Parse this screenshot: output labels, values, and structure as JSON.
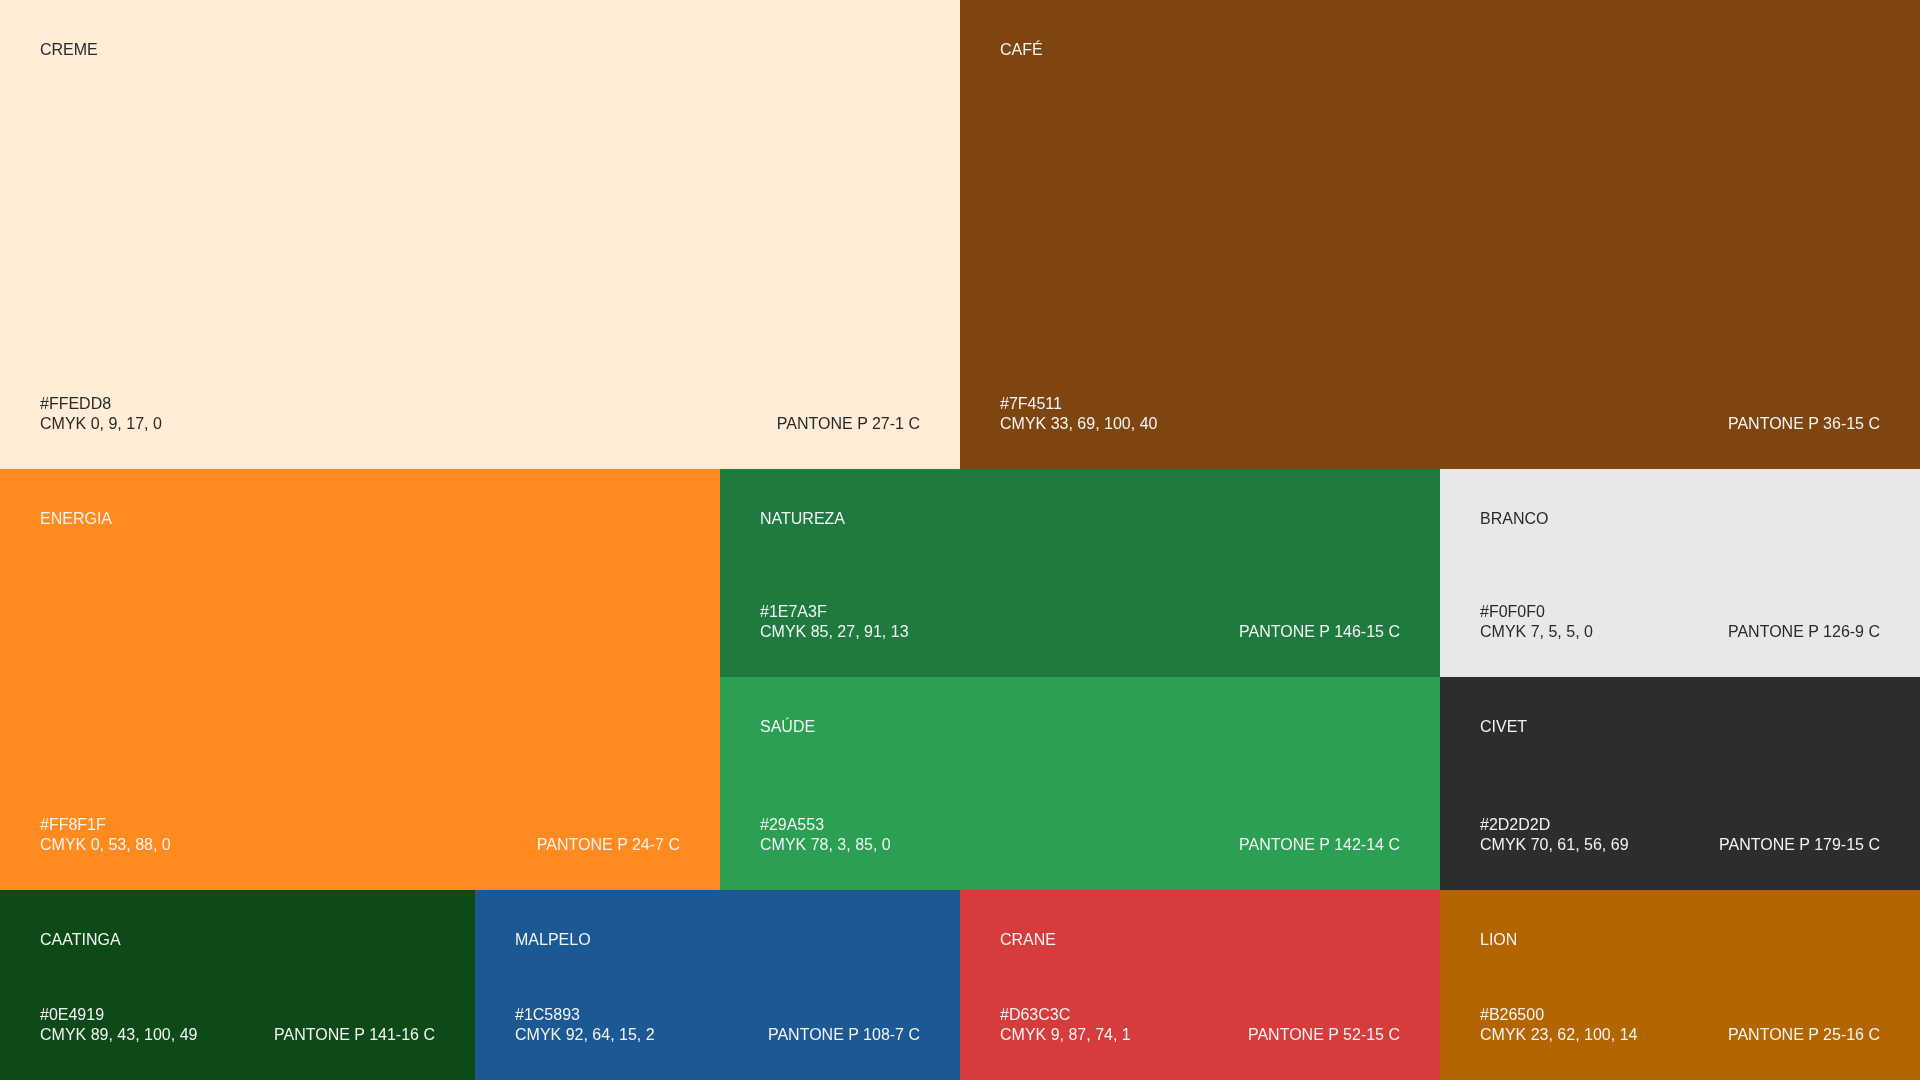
{
  "swatches": [
    {
      "name": "CREME",
      "hex": "#FFEDD8",
      "cmyk": "CMYK 0, 9, 17, 0",
      "pantone": "PANTONE P 27-1 C",
      "color": "#ffedd8"
    },
    {
      "name": "CAFÉ",
      "hex": "#7F4511",
      "cmyk": "CMYK 33, 69, 100, 40",
      "pantone": "PANTONE P 36-15 C",
      "color": "#7f4511"
    },
    {
      "name": "ENERGIA",
      "hex": "#FF8F1F",
      "cmyk": "CMYK 0, 53, 88, 0",
      "pantone": "PANTONE P 24-7 C",
      "color": "#ff8b20"
    },
    {
      "name": "NATUREZA",
      "hex": "#1E7A3F",
      "cmyk": "CMYK 85, 27, 91, 13",
      "pantone": "PANTONE P 146-15 C",
      "color": "#1e7a3f"
    },
    {
      "name": "BRANCO",
      "hex": "#F0F0F0",
      "cmyk": "CMYK 7, 5, 5, 0",
      "pantone": "PANTONE P 126-9 C",
      "color": "#e8e8e8"
    },
    {
      "name": "SAÚDE",
      "hex": "#29A553",
      "cmyk": "CMYK 78, 3, 85, 0",
      "pantone": "PANTONE P 142-14 C",
      "color": "#2ba053"
    },
    {
      "name": "CIVET",
      "hex": "#2D2D2D",
      "cmyk": "CMYK 70, 61, 56, 69",
      "pantone": "PANTONE P 179-15 C",
      "color": "#2d2d2d"
    },
    {
      "name": "CAATINGA",
      "hex": "#0E4919",
      "cmyk": "CMYK 89, 43, 100, 49",
      "pantone": "PANTONE P 141-16 C",
      "color": "#0e4919"
    },
    {
      "name": "MALPELO",
      "hex": "#1C5893",
      "cmyk": "CMYK 92, 64, 15, 2",
      "pantone": "PANTONE P 108-7 C",
      "color": "#1c5893"
    },
    {
      "name": "CRANE",
      "hex": "#D63C3C",
      "cmyk": "CMYK 9, 87, 74, 1",
      "pantone": "PANTONE P 52-15 C",
      "color": "#d63c3c"
    },
    {
      "name": "LION",
      "hex": "#B26500",
      "cmyk": "CMYK 23, 62, 100, 14",
      "pantone": "PANTONE P 25-16 C",
      "color": "#b26500"
    }
  ]
}
